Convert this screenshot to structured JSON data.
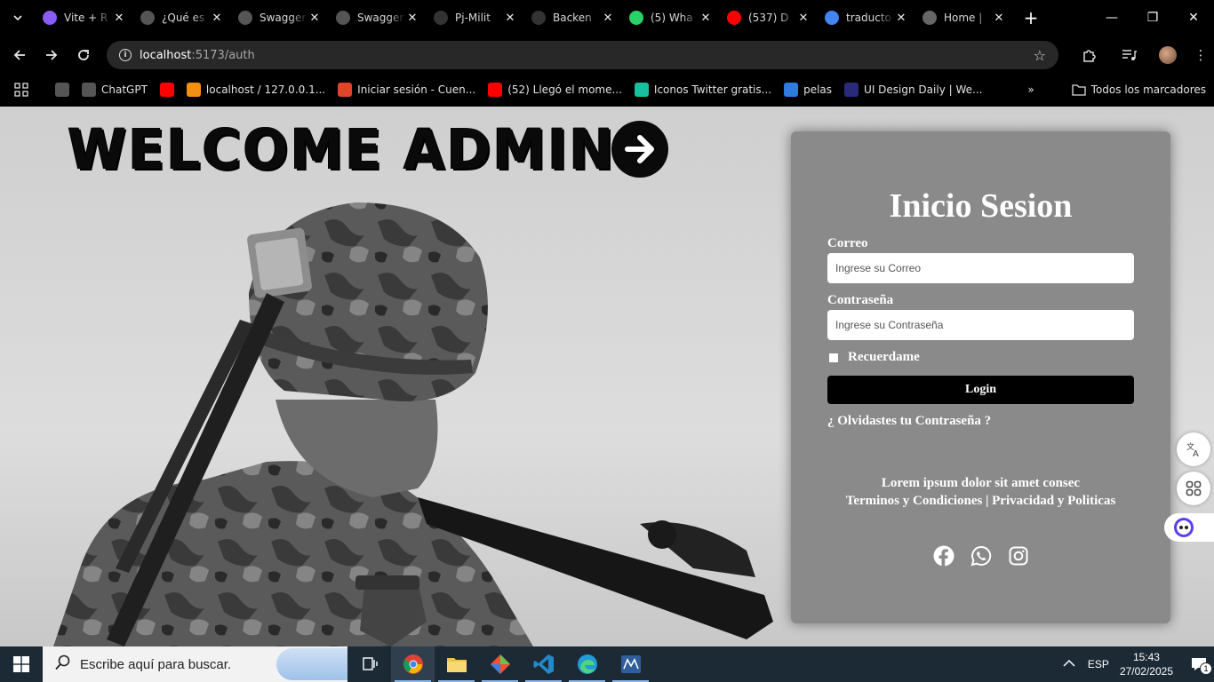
{
  "browser": {
    "tabs": [
      {
        "title": "Vite + R",
        "icon": "vite-icon",
        "color": "#8a5cf6"
      },
      {
        "title": "¿Qué es",
        "icon": "openai-icon",
        "color": "#555555"
      },
      {
        "title": "Swagger",
        "icon": "openai-icon",
        "color": "#555555"
      },
      {
        "title": "Swagger",
        "icon": "openai-icon",
        "color": "#555555"
      },
      {
        "title": "Pj-Milit",
        "icon": "github-icon",
        "color": "#333333"
      },
      {
        "title": "Backen",
        "icon": "github-icon",
        "color": "#333333"
      },
      {
        "title": "(5) Wha",
        "icon": "whatsapp-icon",
        "color": "#25d366"
      },
      {
        "title": "(537) D",
        "icon": "youtube-icon",
        "color": "#ff0000"
      },
      {
        "title": "traducto",
        "icon": "google-icon",
        "color": "#4285f4"
      },
      {
        "title": "Home |",
        "icon": "globe-icon",
        "color": "#666666"
      }
    ],
    "url_host": "localhost",
    "url_path": ":5173/auth",
    "bookmarks": [
      {
        "label": "",
        "icon": "globe-icon",
        "color": "#555"
      },
      {
        "label": "ChatGPT",
        "icon": "openai-icon",
        "color": "#555"
      },
      {
        "label": "",
        "icon": "youtube-icon",
        "color": "#ff0000"
      },
      {
        "label": "localhost / 127.0.0.1...",
        "icon": "phpmyadmin-icon",
        "color": "#f29111"
      },
      {
        "label": "Iniciar sesión - Cuen...",
        "icon": "gitlab-icon",
        "color": "#e24329"
      },
      {
        "label": "(52) Llegó el mome...",
        "icon": "youtube-icon",
        "color": "#ff0000"
      },
      {
        "label": "Iconos Twitter gratis...",
        "icon": "flaticon-icon",
        "color": "#18c0a0"
      },
      {
        "label": "pelas",
        "icon": "edge-icon",
        "color": "#2f7be0"
      },
      {
        "label": "UI Design Daily | We...",
        "icon": "uidesign-icon",
        "color": "#2a2a7a"
      }
    ],
    "all_bookmarks_label": "Todos los marcadores"
  },
  "page": {
    "welcome": "WELCOME ADMIN",
    "login_panel": {
      "title": "Inicio Sesion",
      "email_label": "Correo",
      "email_placeholder": "Ingrese su Correo",
      "password_label": "Contraseña",
      "password_placeholder": "Ingrese su Contraseña",
      "remember_label": "Recuerdame",
      "login_button": "Login",
      "forgot_link": "¿ Olvidastes tu Contraseña ?",
      "footer_line1": "Lorem ipsum dolor sit amet consec",
      "footer_line2": "Terminos y Condiciones | Privacidad y Politicas",
      "social": [
        "facebook-icon",
        "whatsapp-icon",
        "instagram-icon"
      ]
    }
  },
  "taskbar": {
    "search_placeholder": "Escribe aquí para buscar.",
    "language": "ESP",
    "time": "15:43",
    "date": "27/02/2025",
    "notifications": "1"
  }
}
